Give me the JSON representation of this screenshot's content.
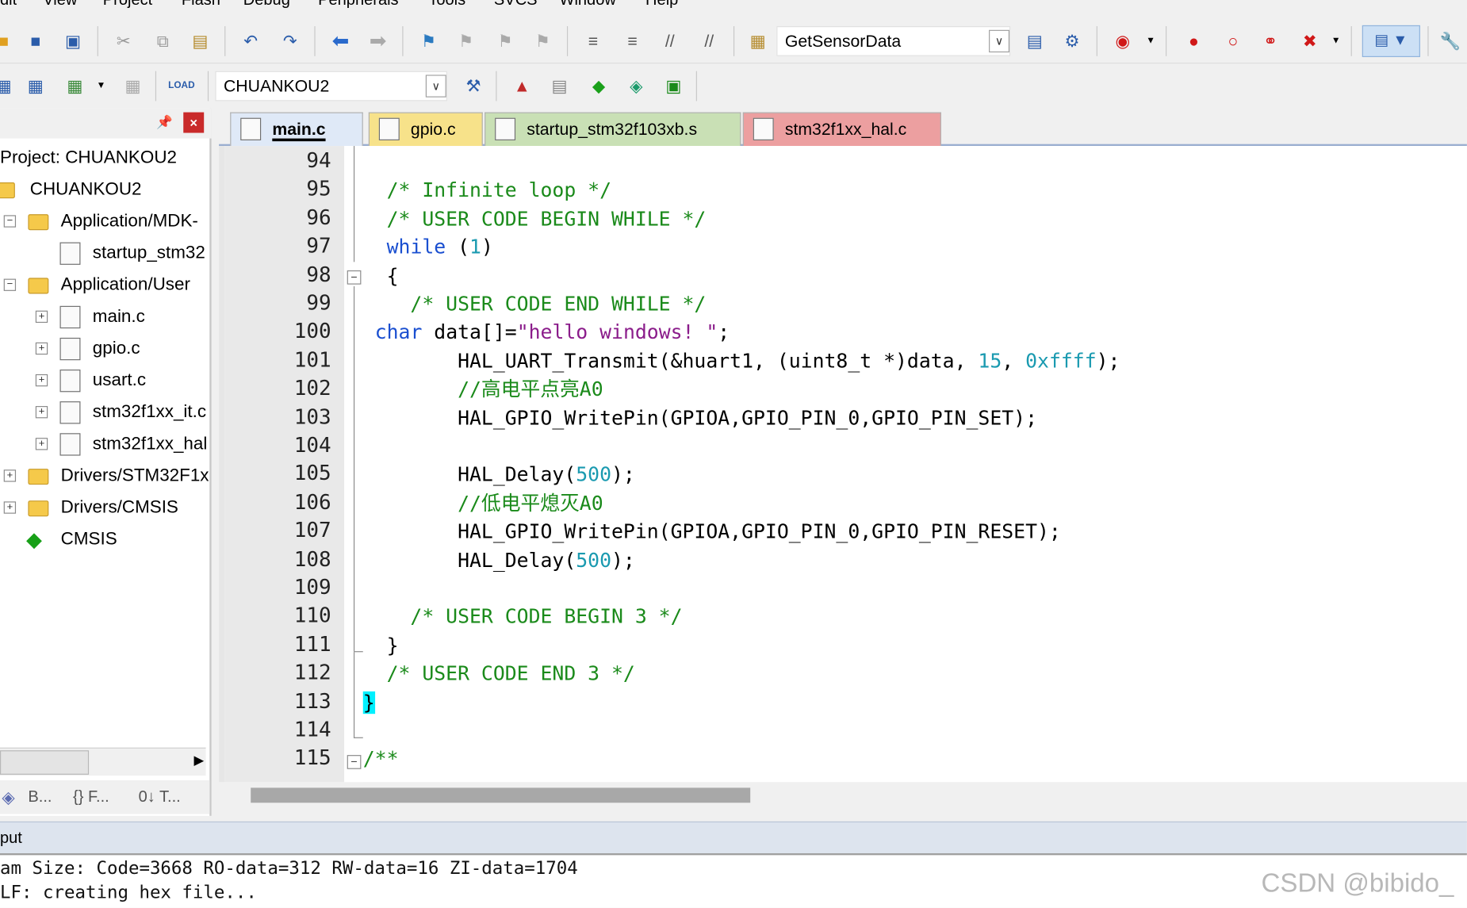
{
  "menu": [
    "dit",
    "View",
    "Project",
    "Flash",
    "Debug",
    "Peripherals",
    "Tools",
    "SVCS",
    "Window",
    "Help"
  ],
  "toolbar": {
    "function_combo": "GetSensorData",
    "target_combo": "CHUANKOU2",
    "load_label": "LOAD"
  },
  "project": {
    "title": "Project: CHUANKOU2",
    "target": "CHUANKOU2",
    "items": [
      {
        "label": "Application/MDK-",
        "type": "folder",
        "expander": "−"
      },
      {
        "label": "startup_stm32",
        "type": "file",
        "expander": ""
      },
      {
        "label": "Application/User",
        "type": "folder",
        "expander": "−"
      },
      {
        "label": "main.c",
        "type": "file",
        "expander": "+"
      },
      {
        "label": "gpio.c",
        "type": "file",
        "expander": "+"
      },
      {
        "label": "usart.c",
        "type": "file",
        "expander": "+"
      },
      {
        "label": "stm32f1xx_it.c",
        "type": "file",
        "expander": "+"
      },
      {
        "label": "stm32f1xx_hal",
        "type": "file",
        "expander": "+"
      },
      {
        "label": "Drivers/STM32F1x",
        "type": "folder",
        "expander": "+"
      },
      {
        "label": "Drivers/CMSIS",
        "type": "folder",
        "expander": "+"
      },
      {
        "label": "CMSIS",
        "type": "component",
        "expander": ""
      }
    ],
    "bottom_tabs": [
      "B...",
      "{} F...",
      "0↓ T..."
    ]
  },
  "tabs": [
    {
      "label": "main.c",
      "active": true,
      "color": "#dfe9f7"
    },
    {
      "label": "gpio.c",
      "active": false,
      "color": "#f7e28a"
    },
    {
      "label": "startup_stm32f103xb.s",
      "active": false,
      "color": "#c9e0b5"
    },
    {
      "label": "stm32f1xx_hal.c",
      "active": false,
      "color": "#ec9fa0"
    }
  ],
  "code": {
    "line_numbers": [
      "94",
      "95",
      "96",
      "97",
      "98",
      "99",
      "100",
      "101",
      "102",
      "103",
      "104",
      "105",
      "106",
      "107",
      "108",
      "109",
      "110",
      "111",
      "112",
      "113",
      "114",
      "115"
    ],
    "lines": [
      [],
      [
        {
          "t": "  /* Infinite loop */",
          "c": "cm"
        }
      ],
      [
        {
          "t": "  /* USER CODE BEGIN WHILE */",
          "c": "cm"
        }
      ],
      [
        {
          "t": "  ",
          "c": ""
        },
        {
          "t": "while",
          "c": "kw"
        },
        {
          "t": " (",
          "c": ""
        },
        {
          "t": "1",
          "c": "num"
        },
        {
          "t": ")",
          "c": ""
        }
      ],
      [
        {
          "t": "  {",
          "c": ""
        }
      ],
      [
        {
          "t": "    /* USER CODE END WHILE */",
          "c": "cm"
        }
      ],
      [
        {
          "t": " ",
          "c": ""
        },
        {
          "t": "char",
          "c": "kw"
        },
        {
          "t": " data[]=",
          "c": ""
        },
        {
          "t": "\"hello windows! \"",
          "c": "str"
        },
        {
          "t": ";",
          "c": ""
        }
      ],
      [
        {
          "t": "        HAL_UART_Transmit(&huart1, (uint8_t *)data, ",
          "c": ""
        },
        {
          "t": "15",
          "c": "num"
        },
        {
          "t": ", ",
          "c": ""
        },
        {
          "t": "0xffff",
          "c": "num"
        },
        {
          "t": ");",
          "c": ""
        }
      ],
      [
        {
          "t": "        //高电平点亮A0",
          "c": "cm"
        }
      ],
      [
        {
          "t": "        HAL_GPIO_WritePin(GPIOA,GPIO_PIN_0,GPIO_PIN_SET);",
          "c": ""
        }
      ],
      [],
      [
        {
          "t": "        HAL_Delay(",
          "c": ""
        },
        {
          "t": "500",
          "c": "num"
        },
        {
          "t": ");",
          "c": ""
        }
      ],
      [
        {
          "t": "        //低电平熄灭A0",
          "c": "cm"
        }
      ],
      [
        {
          "t": "        HAL_GPIO_WritePin(GPIOA,GPIO_PIN_0,GPIO_PIN_RESET);",
          "c": ""
        }
      ],
      [
        {
          "t": "        HAL_Delay(",
          "c": ""
        },
        {
          "t": "500",
          "c": "num"
        },
        {
          "t": ");",
          "c": ""
        }
      ],
      [],
      [
        {
          "t": "    /* USER CODE BEGIN 3 */",
          "c": "cm"
        }
      ],
      [
        {
          "t": "  }",
          "c": ""
        }
      ],
      [
        {
          "t": "  /* USER CODE END 3 */",
          "c": "cm"
        }
      ],
      [
        {
          "t": "}",
          "c": "brhl"
        }
      ],
      [],
      [
        {
          "t": "/**",
          "c": "cm"
        }
      ]
    ]
  },
  "output": {
    "title": "put",
    "lines": [
      "am Size: Code=3668 RO-data=312 RW-data=16 ZI-data=1704",
      "LF: creating hex file..."
    ],
    "watermark": "CSDN @bibido_"
  }
}
